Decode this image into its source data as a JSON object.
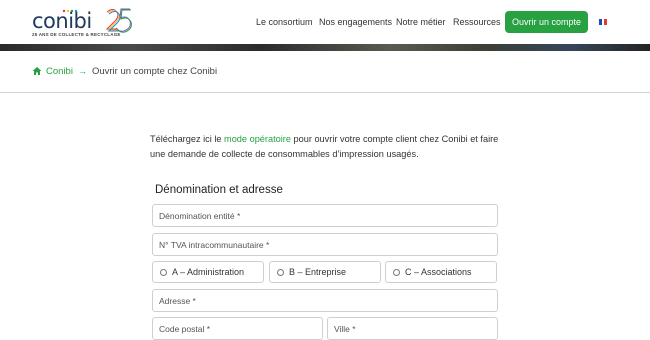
{
  "header": {
    "logo_text": "conibi 25",
    "tagline": "25 ANS DE COLLECTE & RECYCLAGE",
    "nav": [
      "Le consortium",
      "Nos engagements",
      "Notre métier",
      "Ressources"
    ],
    "cta_label": "Ouvrir un compte",
    "language_flag": "flag-fr-icon"
  },
  "breadcrumb": {
    "home_label": "Conibi",
    "separator": "→",
    "current_label": "Ouvrir un compte chez Conibi"
  },
  "intro": {
    "before_link": "Téléchargez ici le ",
    "link_text": "mode opératoire",
    "after_link": " pour ouvrir votre compte client chez Conibi et faire une demande de collecte de consommables d’impression usagés."
  },
  "form": {
    "section_title": "Dénomination et adresse",
    "denomination_placeholder": "Dénomination entité *",
    "tva_placeholder": "N° TVA intracommunautaire *",
    "radio_options": [
      "A – Administration",
      "B – Entreprise",
      "C – Associations"
    ],
    "adresse_placeholder": "Adresse *",
    "code_postal_placeholder": "Code postal *",
    "ville_placeholder": "Ville *"
  },
  "colors": {
    "brand_green": "#27a141",
    "text": "#333333",
    "border": "#cfcfcf"
  }
}
